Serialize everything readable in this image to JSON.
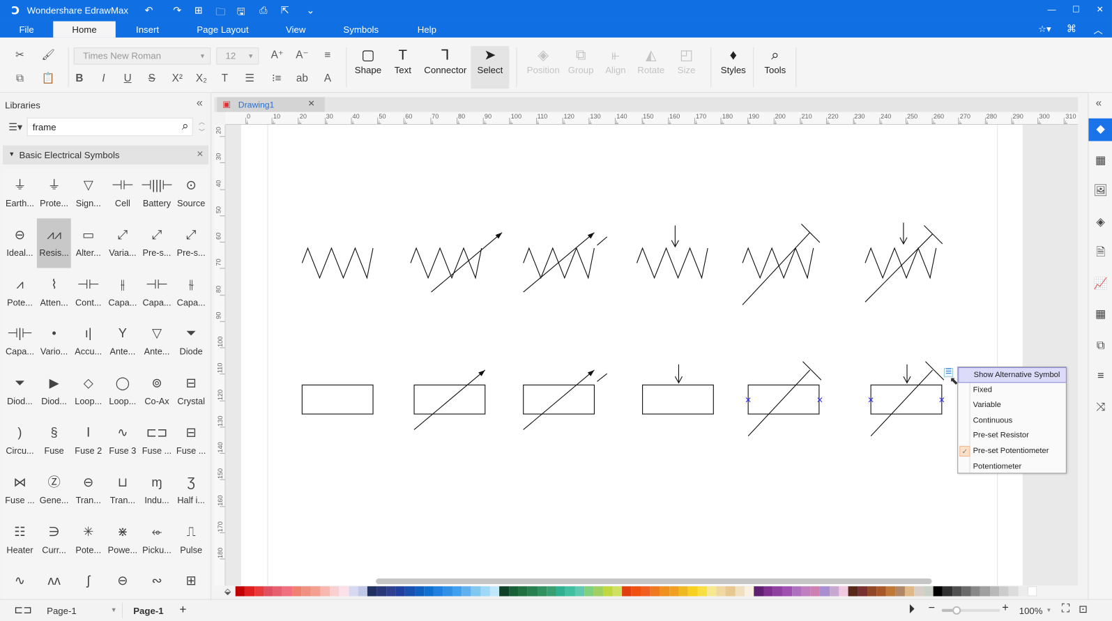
{
  "app": {
    "title": "Wondershare EdrawMax",
    "brand_color": "#0f6fe3"
  },
  "quick_access": [
    {
      "icon": "undo-icon",
      "g": "↶"
    },
    {
      "icon": "redo-icon",
      "g": "↷"
    },
    {
      "icon": "new-icon",
      "g": "⊞"
    },
    {
      "icon": "open-icon",
      "g": "🗀"
    },
    {
      "icon": "save-icon",
      "g": "🖫"
    },
    {
      "icon": "print-icon",
      "g": "⎙"
    },
    {
      "icon": "export-icon",
      "g": "⇱"
    },
    {
      "icon": "customize-icon",
      "g": "⌄"
    }
  ],
  "window_controls": [
    {
      "icon": "minimize-icon",
      "g": "—"
    },
    {
      "icon": "maximize-icon",
      "g": "☐"
    },
    {
      "icon": "close-icon",
      "g": "✕"
    }
  ],
  "menu": {
    "tabs": [
      "File",
      "Home",
      "Insert",
      "Page Layout",
      "View",
      "Symbols",
      "Help"
    ],
    "active": "Home"
  },
  "ribbon": {
    "font_name": "Times New Roman",
    "font_size": "12",
    "big_buttons": [
      {
        "label": "Shape",
        "icon": "shape-icon",
        "g": "▢"
      },
      {
        "label": "Text",
        "icon": "text-icon",
        "g": "T"
      },
      {
        "label": "Connector",
        "icon": "connector-icon",
        "g": "⅂"
      },
      {
        "label": "Select",
        "icon": "select-icon",
        "g": "➤"
      },
      {
        "label": "Position",
        "icon": "position-icon",
        "g": "◈"
      },
      {
        "label": "Group",
        "icon": "group-icon",
        "g": "⧉"
      },
      {
        "label": "Align",
        "icon": "align-icon",
        "g": "⫦"
      },
      {
        "label": "Rotate",
        "icon": "rotate-icon",
        "g": "◭"
      },
      {
        "label": "Size",
        "icon": "size-icon",
        "g": "◰"
      },
      {
        "label": "Styles",
        "icon": "styles-icon",
        "g": "♦"
      },
      {
        "label": "Tools",
        "icon": "tools-icon",
        "g": "⌕"
      }
    ],
    "small_top": [
      {
        "icon": "cut-icon",
        "g": "✂"
      },
      {
        "icon": "format-painter-icon",
        "g": "🖌"
      },
      {
        "icon": "font-grow-icon",
        "g": "A⁺"
      },
      {
        "icon": "font-shrink-icon",
        "g": "A⁻"
      },
      {
        "icon": "align-text-icon",
        "g": "≡"
      }
    ],
    "small_bottom": [
      {
        "icon": "copy-icon",
        "g": "⧉"
      },
      {
        "icon": "paste-icon",
        "g": "📋"
      },
      {
        "icon": "bold-icon",
        "g": "B"
      },
      {
        "icon": "italic-icon",
        "g": "I"
      },
      {
        "icon": "underline-icon",
        "g": "U"
      },
      {
        "icon": "strikethrough-icon",
        "g": "S"
      },
      {
        "icon": "superscript-icon",
        "g": "X²"
      },
      {
        "icon": "subscript-icon",
        "g": "X₂"
      },
      {
        "icon": "text-style-icon",
        "g": "T"
      },
      {
        "icon": "line-spacing-icon",
        "g": "☰"
      },
      {
        "icon": "bullets-icon",
        "g": "⁝≡"
      },
      {
        "icon": "text-highlight-icon",
        "g": "ab"
      },
      {
        "icon": "font-color-icon",
        "g": "A"
      }
    ]
  },
  "libraries": {
    "title": "Libraries",
    "search_value": "frame",
    "category": "Basic Electrical Symbols",
    "items": [
      [
        "Earth...",
        "⏚"
      ],
      [
        "Prote...",
        "⏚"
      ],
      [
        "Sign...",
        "▽"
      ],
      [
        "Cell",
        "⊣⊢"
      ],
      [
        "Battery",
        "⊣|||⊢"
      ],
      [
        "Source",
        "⊙"
      ],
      [
        "Ideal...",
        "⊖"
      ],
      [
        "Resis...",
        "⩘⩘"
      ],
      [
        "Alter...",
        "▭"
      ],
      [
        "Varia...",
        "⤢"
      ],
      [
        "Pre-s...",
        "⤢"
      ],
      [
        "Pre-s...",
        "⤢"
      ],
      [
        "Pote...",
        "⩘"
      ],
      [
        "Atten...",
        "⌇"
      ],
      [
        "Cont...",
        "⊣⊢"
      ],
      [
        "Capa...",
        "⫲"
      ],
      [
        "Capa...",
        "⊣⊢"
      ],
      [
        "Capa...",
        "⫳"
      ],
      [
        "Capa...",
        "⊣|⊢"
      ],
      [
        "Vario...",
        "•"
      ],
      [
        "Accu...",
        "ı|"
      ],
      [
        "Ante...",
        "Y"
      ],
      [
        "Ante...",
        "▽"
      ],
      [
        "Diode",
        "⏷"
      ],
      [
        "Diod...",
        "⏷"
      ],
      [
        "Diod...",
        "▶"
      ],
      [
        "Loop...",
        "◇"
      ],
      [
        "Loop...",
        "◯"
      ],
      [
        "Co-Ax",
        "⊚"
      ],
      [
        "Crystal",
        "⊟"
      ],
      [
        "Circu...",
        ")"
      ],
      [
        "Fuse",
        "§"
      ],
      [
        "Fuse 2",
        "Ⅰ"
      ],
      [
        "Fuse 3",
        "∿"
      ],
      [
        "Fuse ...",
        "⊏⊐"
      ],
      [
        "Fuse ...",
        "⊟"
      ],
      [
        "Fuse ...",
        "⋈"
      ],
      [
        "Gene...",
        "Ⓩ"
      ],
      [
        "Tran...",
        "⊖"
      ],
      [
        "Tran...",
        "⊔"
      ],
      [
        "Indu...",
        "ɱ"
      ],
      [
        "Half i...",
        "Ʒ"
      ],
      [
        "Heater",
        "☷"
      ],
      [
        "Curr...",
        "∋"
      ],
      [
        "Pote...",
        "✳"
      ],
      [
        "Powe...",
        "⋇"
      ],
      [
        "Picku...",
        "⬰"
      ],
      [
        "Pulse",
        "⎍"
      ],
      [
        "",
        "∿"
      ],
      [
        "",
        "ʌʌ"
      ],
      [
        "",
        "ʃ"
      ],
      [
        "",
        "⊖"
      ],
      [
        "",
        "∾"
      ],
      [
        "",
        "⊞"
      ]
    ],
    "selected": 7
  },
  "document": {
    "tab": "Drawing1"
  },
  "ruler": {
    "top": [
      0,
      10,
      20,
      30,
      40,
      50,
      60,
      70,
      80,
      90,
      100,
      110,
      120,
      130,
      140,
      150,
      160,
      170,
      180,
      190,
      200,
      210,
      220,
      230,
      240,
      250,
      260,
      270,
      280,
      290,
      300,
      310
    ],
    "left": [
      20,
      30,
      40,
      50,
      60,
      70,
      80,
      90,
      100,
      110,
      120,
      130,
      140,
      150,
      160,
      170,
      180
    ]
  },
  "context_menu": {
    "items": [
      "Show Alternative Symbol",
      "Fixed",
      "Variable",
      "Continuous",
      "Pre-set Resistor",
      "Pre-set Potentiometer",
      "Potentiometer"
    ],
    "highlighted": "Show Alternative Symbol",
    "checked": "Pre-set Potentiometer"
  },
  "right_panel": [
    {
      "icon": "fill-icon",
      "g": "◆"
    },
    {
      "icon": "grid-icon",
      "g": "▦"
    },
    {
      "icon": "image-icon",
      "g": "🖼"
    },
    {
      "icon": "layers-icon",
      "g": "◈"
    },
    {
      "icon": "page-icon",
      "g": "🗎"
    },
    {
      "icon": "chart-icon",
      "g": "📈"
    },
    {
      "icon": "table-icon",
      "g": "▦"
    },
    {
      "icon": "data-icon",
      "g": "⧉"
    },
    {
      "icon": "outline-icon",
      "g": "≡"
    },
    {
      "icon": "shuffle-icon",
      "g": "⤨"
    }
  ],
  "palette": [
    "#c00000",
    "#e02020",
    "#e83a3a",
    "#e05060",
    "#e86070",
    "#f07080",
    "#f08070",
    "#f09080",
    "#f4a090",
    "#f8b8b0",
    "#f8d0d0",
    "#fce0ea",
    "#d8d8f0",
    "#c0c8e8",
    "#203060",
    "#283878",
    "#304090",
    "#2040a0",
    "#1850b0",
    "#1060c0",
    "#1070d0",
    "#2080e0",
    "#3090e8",
    "#40a0f0",
    "#60b0f0",
    "#80c8f0",
    "#a0d8f8",
    "#c0e8fc",
    "#104028",
    "#186038",
    "#207040",
    "#288050",
    "#309060",
    "#38a070",
    "#30b090",
    "#40c0a0",
    "#60c8b0",
    "#80d080",
    "#a0d060",
    "#c0d840",
    "#d0e060",
    "#e04010",
    "#f05010",
    "#f06020",
    "#f07820",
    "#f09020",
    "#f0a020",
    "#f0b820",
    "#f8d020",
    "#f8e040",
    "#f8e890",
    "#f0d8a0",
    "#e8c890",
    "#f0e0c0",
    "#f8f0e0",
    "#602070",
    "#803090",
    "#9040a0",
    "#a050b0",
    "#b070c0",
    "#c080c0",
    "#d080b0",
    "#a890d0",
    "#c8a8d0",
    "#f0c8e0",
    "#582818",
    "#783030",
    "#904828",
    "#a85828",
    "#c07838",
    "#b08868",
    "#e0b888",
    "#d8d0c8",
    "#c8d0c8",
    "#000000",
    "#303030",
    "#505050",
    "#6a6a6a",
    "#888888",
    "#a0a0a0",
    "#b8b8b8",
    "#cccccc",
    "#dcdcdc",
    "#ececec",
    "#ffffff"
  ],
  "status": {
    "page_selector": "Page-1",
    "page_tab": "Page-1",
    "zoom": "100%",
    "zoom_fraction": 0.25
  }
}
